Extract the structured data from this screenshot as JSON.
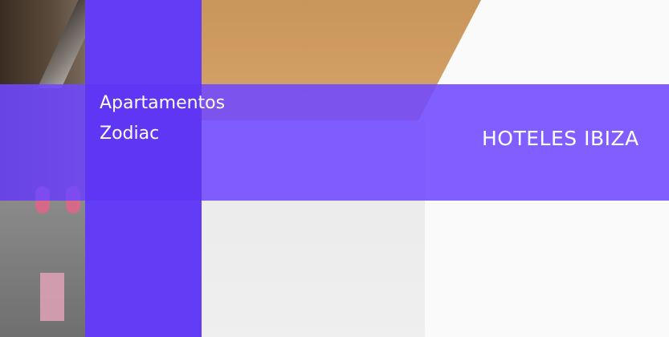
{
  "hero": {
    "title_line1": "Apartamentos",
    "title_line2": "Zodiac",
    "category_link": "HOTELES IBIZA"
  },
  "colors": {
    "overlay_band": "#7048ff",
    "left_column": "#643cf5",
    "text": "#ffffff"
  }
}
